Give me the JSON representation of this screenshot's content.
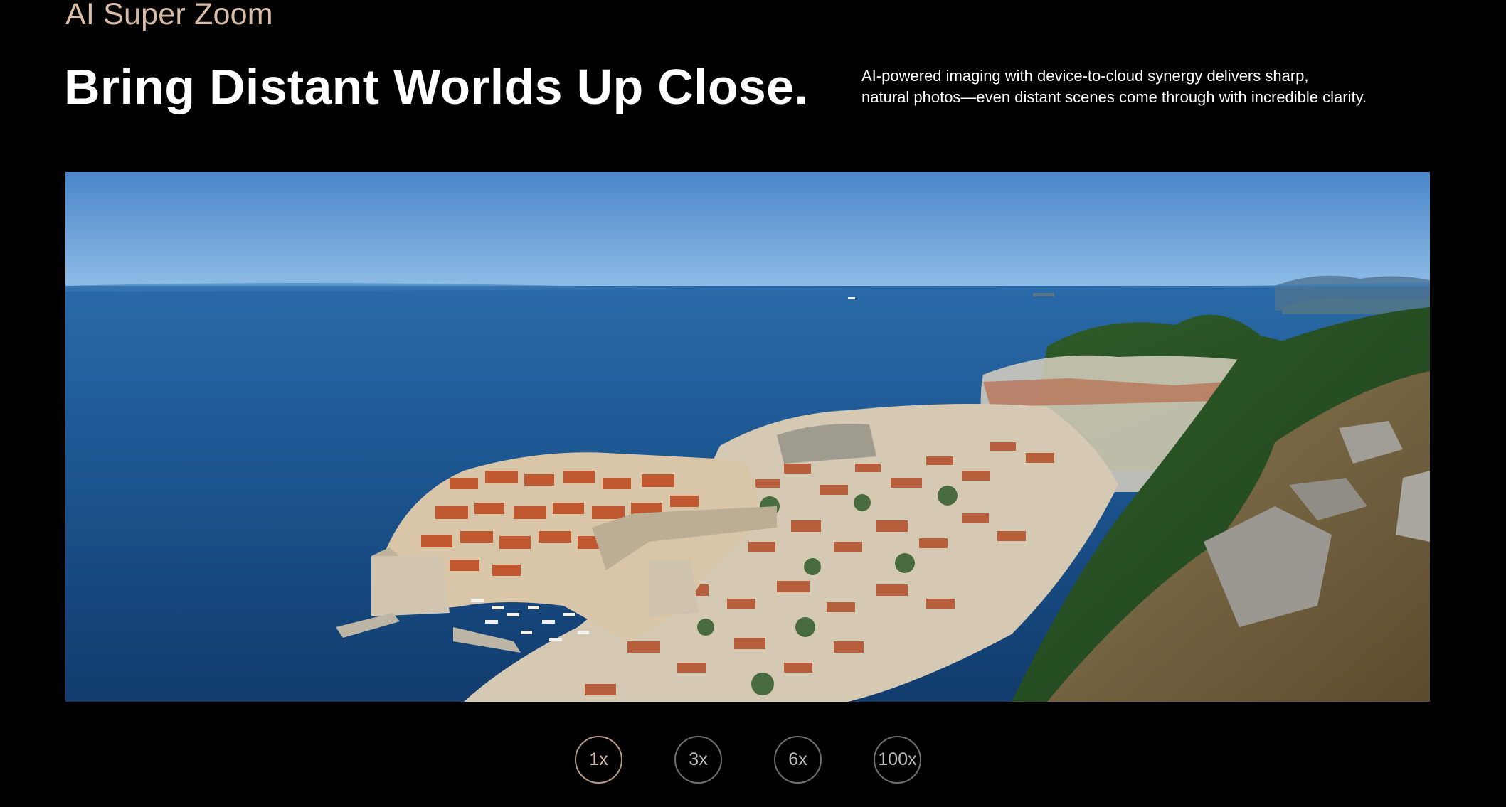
{
  "section": {
    "eyebrow": "AI Super Zoom",
    "headline": "Bring Distant Worlds Up Close.",
    "description_lines": [
      "AI-powered imaging with device-to-cloud synergy delivers sharp,",
      "natural photos—even distant scenes come through with incredible clarity."
    ]
  },
  "photo": {
    "subject": "coastal-old-town-panorama"
  },
  "zoom": {
    "options": [
      "1x",
      "3x",
      "6x",
      "100x"
    ],
    "selected": "1x"
  },
  "colors": {
    "background": "#000000",
    "eyebrow": "#d9bca8",
    "active_ring": "#b89a84",
    "inactive_ring": "#6f6f6f"
  }
}
